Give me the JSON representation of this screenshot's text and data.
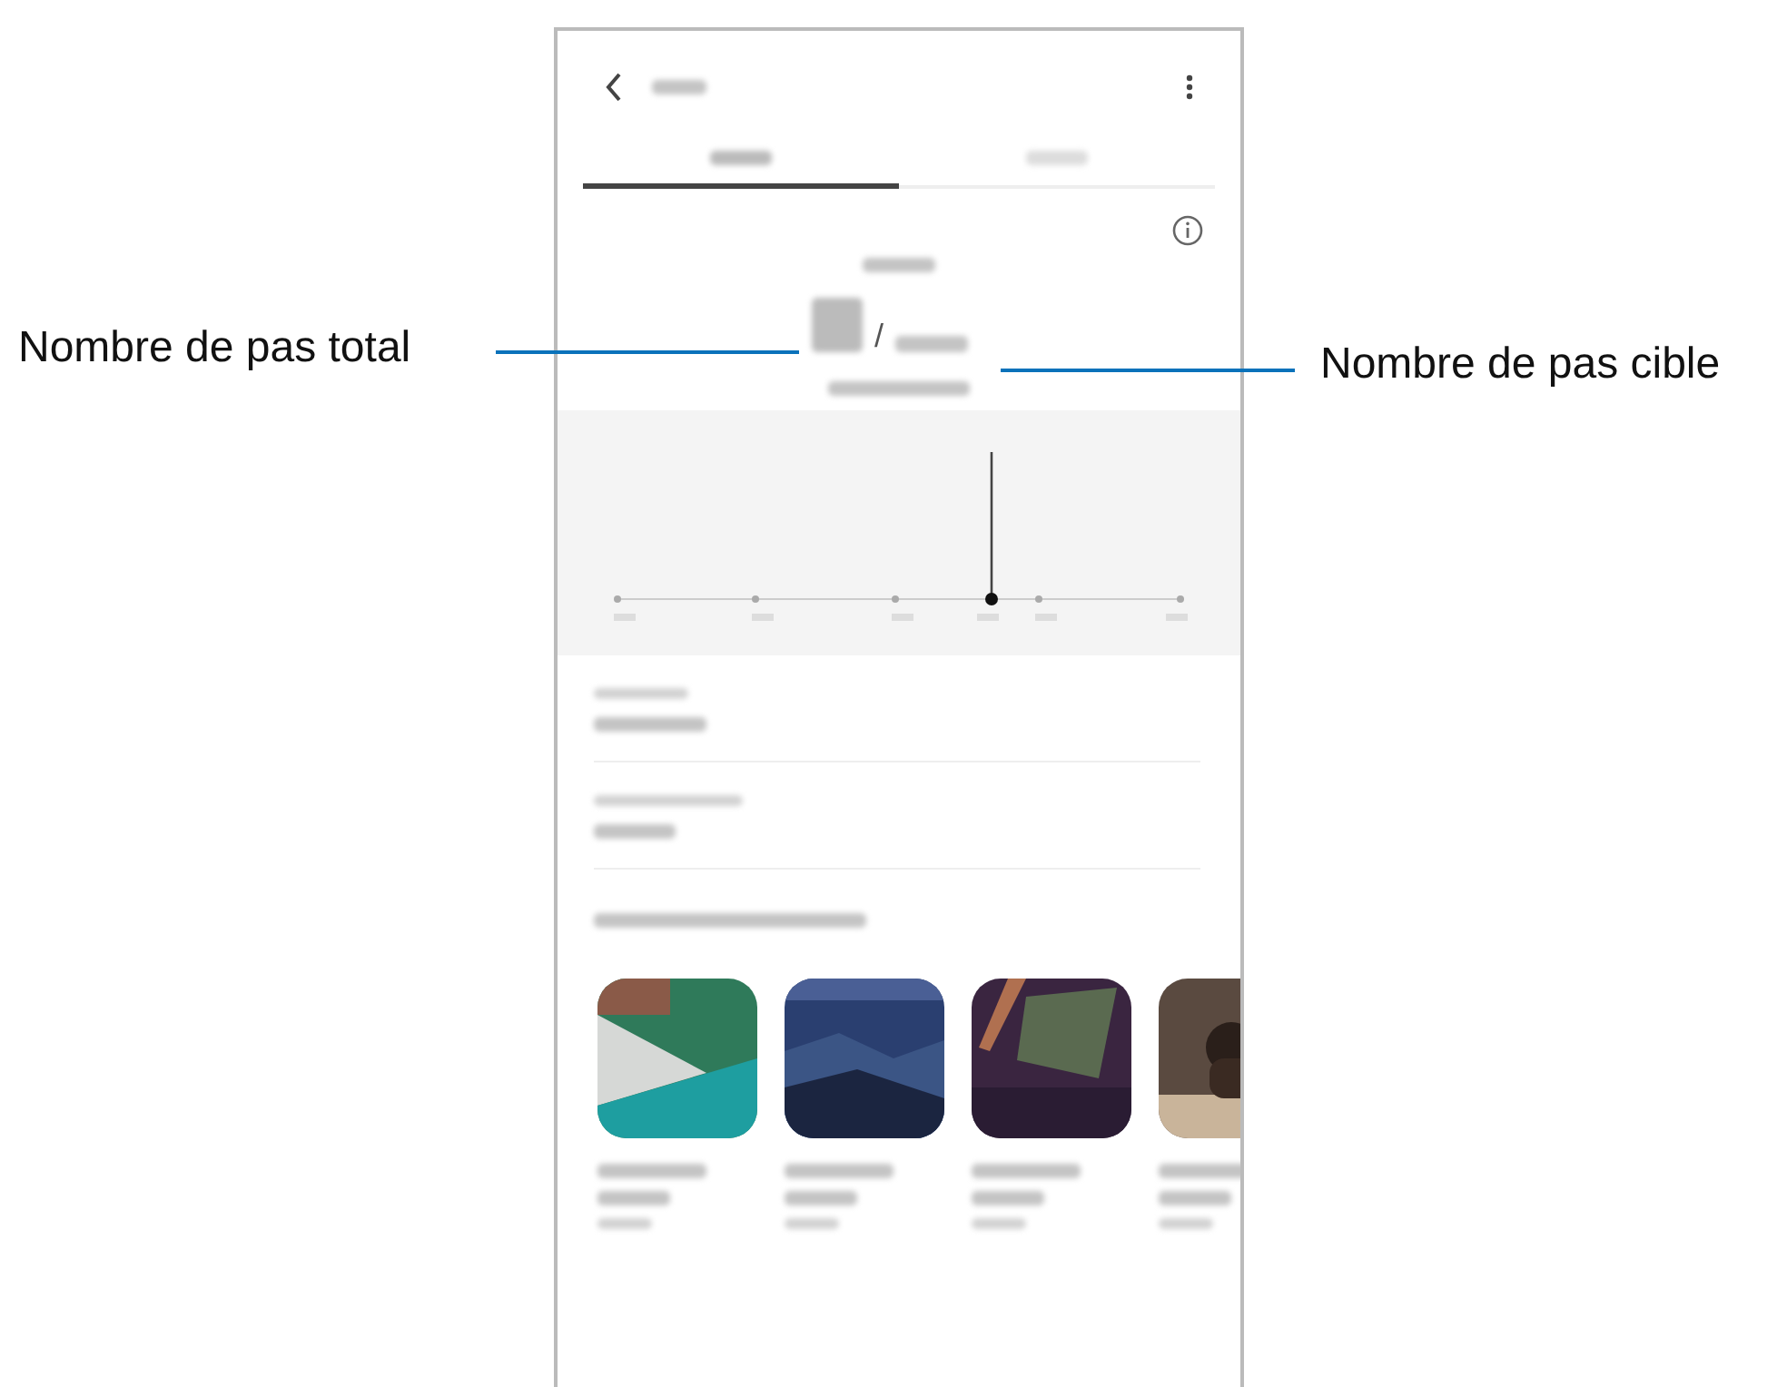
{
  "left_callout": {
    "label": "Nombre de pas total"
  },
  "right_callout": {
    "label": "Nombre de pas cible"
  },
  "screen": {
    "tabs": [
      {
        "selected": true
      },
      {
        "selected": false
      }
    ],
    "steps": {
      "separator": "/"
    }
  }
}
